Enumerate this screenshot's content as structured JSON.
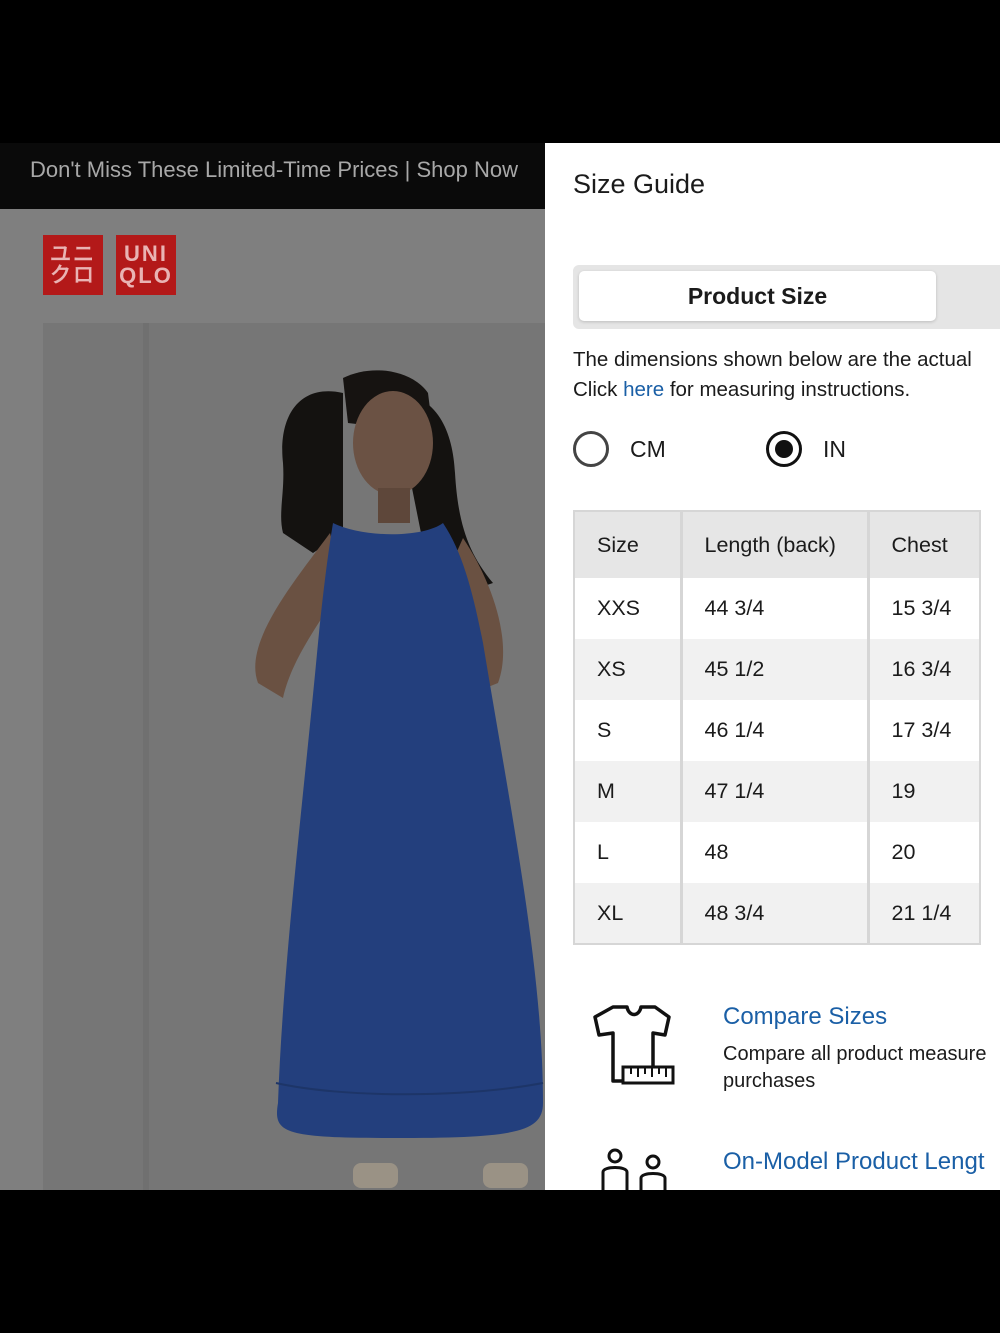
{
  "promo_banner": "Don't Miss These Limited-Time Prices | Shop Now",
  "logo": {
    "top_left": "ユニ",
    "bottom_left": "クロ",
    "top_right": "UNI",
    "bottom_right": "QLO"
  },
  "size_guide": {
    "title": "Size Guide",
    "tabs": [
      {
        "label": "Product Size",
        "active": true
      }
    ],
    "description_line1": "The dimensions shown below are the actual",
    "description_prefix": "Click ",
    "description_link": "here",
    "description_suffix": " for measuring instructions.",
    "units": [
      {
        "label": "CM",
        "selected": false
      },
      {
        "label": "IN",
        "selected": true
      }
    ],
    "table": {
      "headers": [
        "Size",
        "Length (back)",
        "Chest"
      ],
      "rows": [
        [
          "XXS",
          "44 3/4",
          "15 3/4"
        ],
        [
          "XS",
          "45 1/2",
          "16 3/4"
        ],
        [
          "S",
          "46 1/4",
          "17 3/4"
        ],
        [
          "M",
          "47 1/4",
          "19"
        ],
        [
          "L",
          "48",
          "20"
        ],
        [
          "XL",
          "48 3/4",
          "21 1/4"
        ]
      ]
    },
    "features": [
      {
        "icon": "tshirt-ruler-icon",
        "title": "Compare Sizes",
        "desc_line1": "Compare all product measure",
        "desc_line2": "purchases"
      },
      {
        "icon": "models-icon",
        "title": "On-Model Product Lengt"
      }
    ]
  },
  "colors": {
    "brand_red": "#b31919",
    "link_blue": "#1a5fa6",
    "dress_blue": "#233f7d"
  }
}
